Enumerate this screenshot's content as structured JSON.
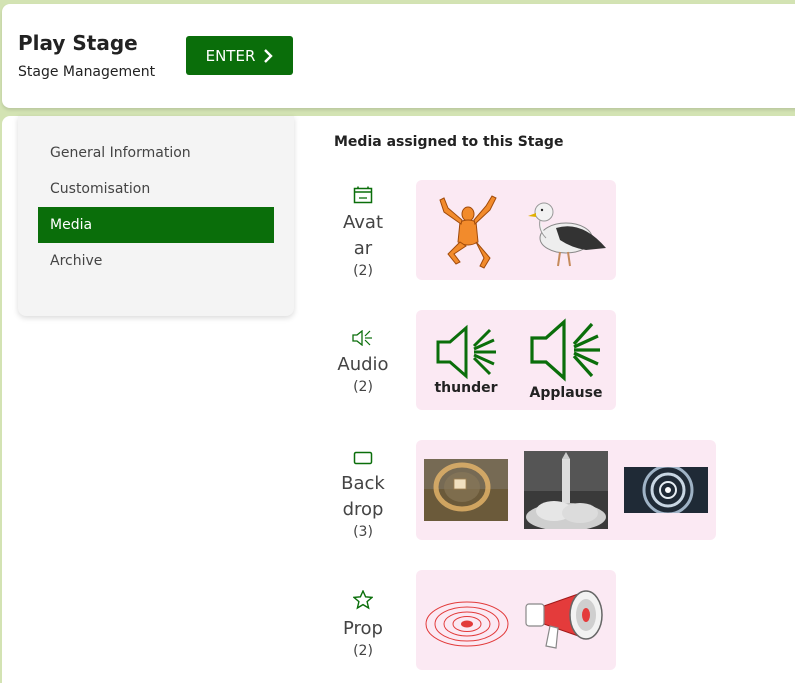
{
  "header": {
    "title": "Play Stage",
    "subtitle": "Stage Management",
    "enter_label": "ENTER"
  },
  "sidebar": {
    "items": [
      {
        "label": "General Information",
        "active": false
      },
      {
        "label": "Customisation",
        "active": false
      },
      {
        "label": "Media",
        "active": true
      },
      {
        "label": "Archive",
        "active": false
      }
    ]
  },
  "main": {
    "heading": "Media assigned to this Stage",
    "categories": [
      {
        "name": "Avatar",
        "count": "(2)",
        "icon": "avatar-icon"
      },
      {
        "name": "Audio",
        "count": "(2)",
        "icon": "speaker-icon",
        "items": [
          "thunder",
          "Applause"
        ]
      },
      {
        "name": "Backdrop",
        "count": "(3)",
        "icon": "backdrop-icon"
      },
      {
        "name": "Prop",
        "count": "(2)",
        "icon": "star-icon"
      }
    ]
  },
  "colors": {
    "accent": "#0a6e0a",
    "page_bg": "#d3e3b3",
    "media_box_bg": "#fbe9f3",
    "menu_bg": "#f4f4f4"
  }
}
